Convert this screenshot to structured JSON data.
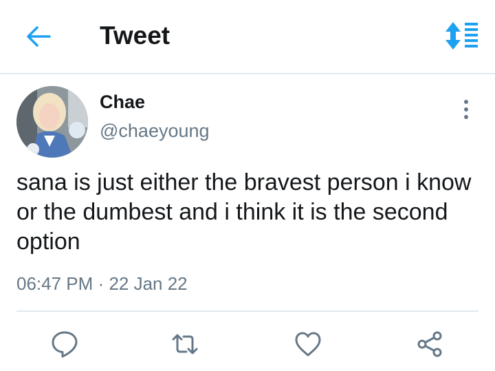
{
  "header": {
    "title": "Tweet",
    "back_icon": "arrow-left-icon",
    "sort_icon": "sort-list-icon"
  },
  "tweet": {
    "author_name": "Chae",
    "author_handle": "@chaeyoung",
    "text": "sana is just either the bravest person i know or the dumbest and i think it is the second option",
    "time": "06:47 PM",
    "separator": "·",
    "date": "22 Jan 22"
  },
  "actions": {
    "reply_icon": "reply-icon",
    "retweet_icon": "retweet-icon",
    "like_icon": "heart-icon",
    "share_icon": "share-icon"
  },
  "colors": {
    "accent": "#1da1f2",
    "text": "#14171a",
    "muted": "#657786",
    "divider": "#e1e8ed"
  }
}
